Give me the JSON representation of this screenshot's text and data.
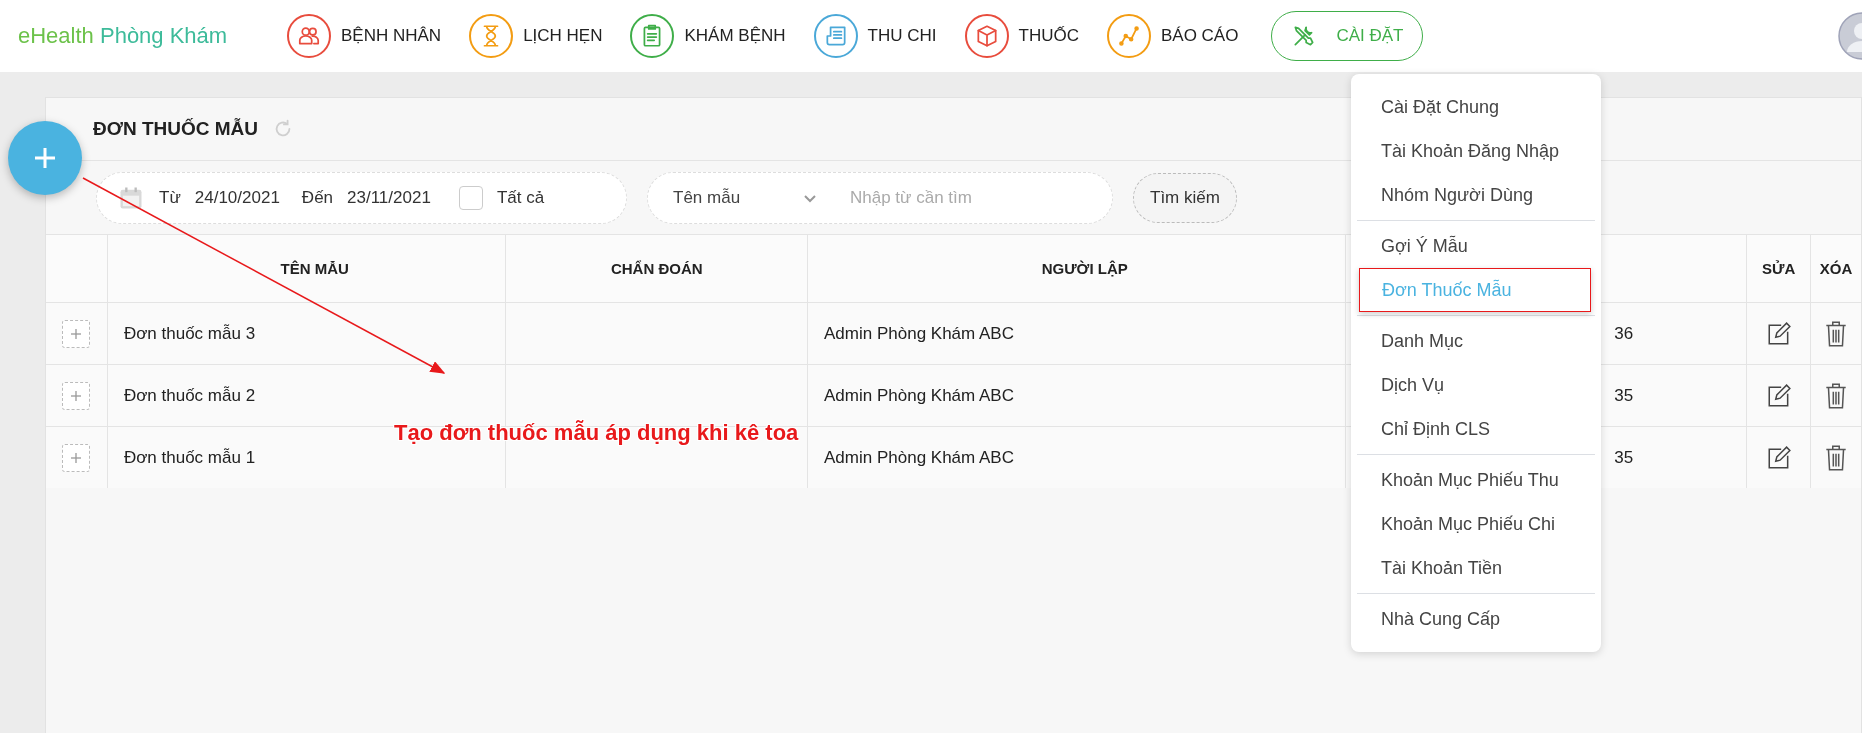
{
  "brand": {
    "first": "eHealth",
    "second": "Phòng Khám"
  },
  "nav": [
    {
      "label": "BỆNH NHÂN",
      "kind": "people",
      "color": "#e84c3d",
      "selected": false
    },
    {
      "label": "LỊCH HẸN",
      "kind": "hourglass",
      "color": "#f39c12",
      "selected": false
    },
    {
      "label": "KHÁM BỆNH",
      "kind": "clipboard",
      "color": "#3fae49",
      "selected": false
    },
    {
      "label": "THU CHI",
      "kind": "receipt",
      "color": "#4aa8d8",
      "selected": false
    },
    {
      "label": "THUỐC",
      "kind": "box",
      "color": "#e84c3d",
      "selected": false
    },
    {
      "label": "BÁO CÁO",
      "kind": "chart",
      "color": "#f39c12",
      "selected": false
    },
    {
      "label": "CÀI ĐẶT",
      "kind": "tools",
      "color": "#3fae49",
      "selected": true
    }
  ],
  "page": {
    "title": "ĐƠN THUỐC MẪU"
  },
  "filters": {
    "from_label": "Từ",
    "from": "24/10/2021",
    "to_label": "Đến",
    "to": "23/11/2021",
    "all": {
      "label": "Tất cả",
      "checked": false
    },
    "field": "Tên mẫu",
    "search": {
      "placeholder": "Nhập từ cần tìm"
    },
    "search_button": "Tìm kiếm"
  },
  "table": {
    "columns": {
      "name": "TÊN MẪU",
      "diagnosis": "CHẨN ĐOÁN",
      "creator": "NGƯỜI LẬP",
      "edit": "SỬA",
      "delete": "XÓA"
    },
    "rows": [
      {
        "expanded": false,
        "name": "Đơn thuốc mẫu 3",
        "creator": "Admin Phòng Khám ABC",
        "column_4": "36"
      },
      {
        "expanded": false,
        "name": "Đơn thuốc mẫu 2",
        "creator": "Admin Phòng Khám ABC",
        "column_4": "35"
      },
      {
        "expanded": false,
        "name": "Đơn thuốc mẫu 1",
        "creator": "Admin Phòng Khám ABC",
        "column_4": "35"
      }
    ]
  },
  "settings_menu": {
    "groups": [
      [
        {
          "label": "Cài Đặt Chung",
          "selected": false
        },
        {
          "label": "Tài Khoản Đăng Nhập",
          "selected": false
        },
        {
          "label": "Nhóm Người Dùng",
          "selected": false
        }
      ],
      [
        {
          "label": "Gợi Ý Mẫu",
          "selected": false
        },
        {
          "label": "Đơn Thuốc Mẫu",
          "selected": true
        }
      ],
      [
        {
          "label": "Danh Mục",
          "selected": false
        },
        {
          "label": "Dịch Vụ",
          "selected": false
        },
        {
          "label": "Chỉ Định CLS",
          "selected": false
        }
      ],
      [
        {
          "label": "Khoản Mục Phiếu Thu",
          "selected": false
        },
        {
          "label": "Khoản Mục Phiếu Chi",
          "selected": false
        },
        {
          "label": "Tài Khoản Tiền",
          "selected": false
        }
      ],
      [
        {
          "label": "Nhà Cung Cấp",
          "selected": false
        }
      ]
    ]
  },
  "annotation": {
    "text": "Tạo đơn thuốc mẫu áp dụng khi kê toa"
  }
}
